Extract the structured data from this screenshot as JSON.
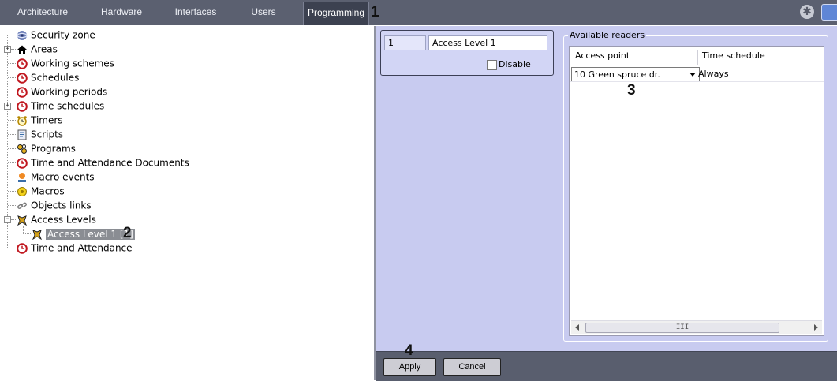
{
  "tabs": [
    {
      "label": "Architecture"
    },
    {
      "label": "Hardware"
    },
    {
      "label": "Interfaces"
    },
    {
      "label": "Users"
    },
    {
      "label": "Programming"
    }
  ],
  "callouts": [
    "1",
    "2",
    "3",
    "4"
  ],
  "tree": {
    "items": [
      {
        "label": "Security zone",
        "icon": "security-zone-icon"
      },
      {
        "label": "Areas",
        "icon": "house-icon"
      },
      {
        "label": "Working schemes",
        "icon": "clock-icon"
      },
      {
        "label": "Schedules",
        "icon": "clock-icon"
      },
      {
        "label": "Working periods",
        "icon": "clock-icon"
      },
      {
        "label": "Time schedules",
        "icon": "clock-icon"
      },
      {
        "label": "Timers",
        "icon": "alarm-clock-icon"
      },
      {
        "label": "Scripts",
        "icon": "script-icon"
      },
      {
        "label": "Programs",
        "icon": "programs-icon"
      },
      {
        "label": "Time and Attendance Documents",
        "icon": "clock-icon"
      },
      {
        "label": "Macro events",
        "icon": "macro-event-icon"
      },
      {
        "label": "Macros",
        "icon": "macro-icon"
      },
      {
        "label": "Objects links",
        "icon": "link-icon"
      },
      {
        "label": "Access Levels",
        "icon": "access-level-icon"
      },
      {
        "label": "Access Level 1 [1]",
        "icon": "access-level-icon"
      },
      {
        "label": "Time and Attendance",
        "icon": "clock-icon"
      }
    ]
  },
  "form": {
    "id_value": "1",
    "name_value": "Access Level 1",
    "disable_label": "Disable",
    "disable_checked": false
  },
  "readers": {
    "group_title": "Available readers",
    "columns": [
      "Access point",
      "Time schedule"
    ],
    "rows": [
      {
        "access_point": "10 Green spruce dr.",
        "time_schedule": "Always"
      }
    ],
    "scroll_thumb_label": "III"
  },
  "buttons": {
    "apply": "Apply",
    "cancel": "Cancel"
  },
  "colors": {
    "tabbar": "#5b6070",
    "panel": "#c8cbf0",
    "bottombar": "#595e6e",
    "selection": "#8a8d93"
  }
}
